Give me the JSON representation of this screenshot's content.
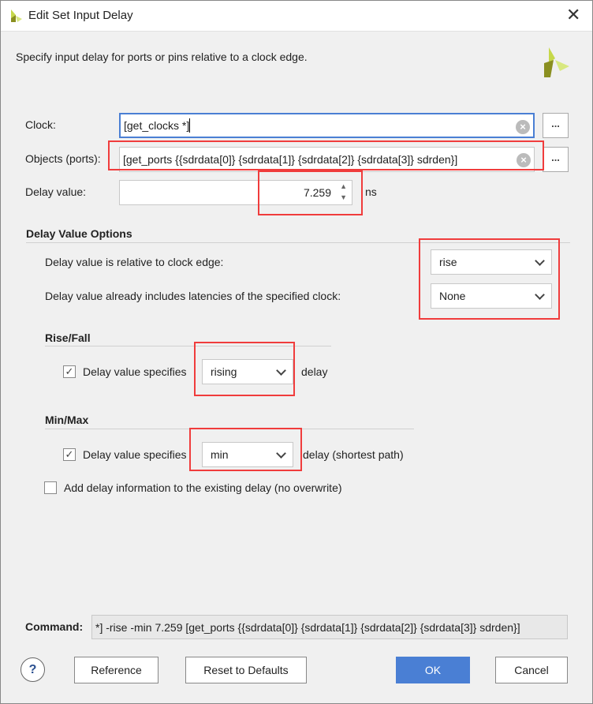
{
  "window": {
    "title": "Edit Set Input Delay",
    "close_icon": "close-icon"
  },
  "description": "Specify input delay for ports or pins relative to a clock edge.",
  "form": {
    "clock_label": "Clock:",
    "clock_value": "[get_clocks *]",
    "objects_label": "Objects (ports):",
    "objects_value": "[get_ports {{sdrdata[0]} {sdrdata[1]} {sdrdata[2]} {sdrdata[3]} sdrden}]",
    "delay_label": "Delay value:",
    "delay_value": "7.259",
    "delay_unit": "ns",
    "browse_label": "..."
  },
  "options": {
    "heading": "Delay Value Options",
    "clock_edge_label": "Delay value is relative to clock edge:",
    "clock_edge_value": "rise",
    "latency_label": "Delay value already includes latencies of the specified clock:",
    "latency_value": "None"
  },
  "rise_fall": {
    "heading": "Rise/Fall",
    "checked": true,
    "label": "Delay value specifies",
    "value": "rising",
    "suffix": "delay"
  },
  "min_max": {
    "heading": "Min/Max",
    "checked": true,
    "label": "Delay value specifies",
    "value": "min",
    "suffix": "delay (shortest path)"
  },
  "add_delay": {
    "checked": false,
    "label": "Add delay information to the existing delay (no overwrite)"
  },
  "command": {
    "label": "Command:",
    "value": "*] -rise -min 7.259 [get_ports {{sdrdata[0]} {sdrdata[1]} {sdrdata[2]} {sdrdata[3]} sdrden}]"
  },
  "buttons": {
    "help": "?",
    "reference": "Reference",
    "reset": "Reset to Defaults",
    "ok": "OK",
    "cancel": "Cancel"
  },
  "colors": {
    "ok": "#4a7fd4",
    "annotation": "#f03c3c",
    "focus": "#4a7fd4"
  }
}
